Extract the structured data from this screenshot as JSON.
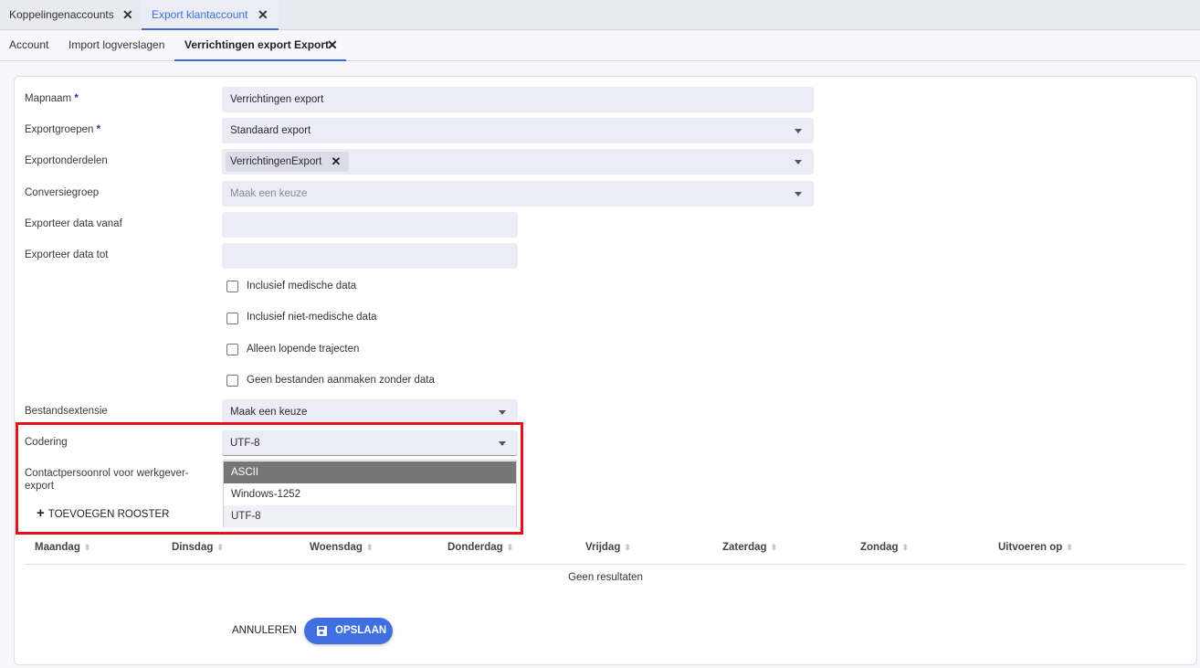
{
  "top_tabs": [
    {
      "label": "Koppelingenaccounts",
      "close": "✕"
    },
    {
      "label": "Export klantaccount",
      "close": "✕"
    }
  ],
  "sub_tabs": [
    {
      "label": "Account"
    },
    {
      "label": "Import logverslagen"
    },
    {
      "label": "Verrichtingen export Export",
      "close": "✕"
    }
  ],
  "form": {
    "mapnaam": {
      "label": "Mapnaam",
      "required": "*",
      "value": "Verrichtingen export"
    },
    "exportgroepen": {
      "label": "Exportgroepen",
      "required": "*",
      "value": "Standaard export"
    },
    "exportonderdelen": {
      "label": "Exportonderdelen",
      "chip": "VerrichtingenExport",
      "chip_remove": "✕"
    },
    "conversiegroep": {
      "label": "Conversiegroep",
      "placeholder": "Maak een keuze"
    },
    "vanaf": {
      "label": "Exporteer data vanaf",
      "value": ""
    },
    "tot": {
      "label": "Exporteer data tot",
      "value": ""
    },
    "checkboxes": [
      {
        "label": "Inclusief medische data",
        "checked": false
      },
      {
        "label": "Inclusief niet-medische data",
        "checked": false
      },
      {
        "label": "Alleen lopende trajecten",
        "checked": false
      },
      {
        "label": "Geen bestanden aanmaken zonder data",
        "checked": false
      }
    ],
    "bestandsextensie": {
      "label": "Bestandsextensie",
      "value": "Maak een keuze"
    },
    "codering": {
      "label": "Codering",
      "value": "UTF-8",
      "options": [
        "ASCII",
        "Windows-1252",
        "UTF-8"
      ],
      "highlighted": "ASCII"
    },
    "contactpersoonrol": {
      "label_line1": "Contactpersoonrol voor werkgever-",
      "label_line2": "export"
    }
  },
  "add_schedule": {
    "icon": "plus-icon",
    "label": "TOEVOEGEN ROOSTER"
  },
  "table": {
    "columns": [
      "Maandag",
      "Dinsdag",
      "Woensdag",
      "Donderdag",
      "Vrijdag",
      "Zaterdag",
      "Zondag",
      "Uitvoeren op"
    ],
    "empty_text": "Geen resultaten"
  },
  "actions": {
    "cancel": "ANNULEREN",
    "save": "OPSLAAN",
    "save_icon": "save-disk-icon"
  },
  "colors": {
    "accent": "#3f6fe0",
    "highlight_box": "#e4101a",
    "field_bg": "#ececf7"
  }
}
